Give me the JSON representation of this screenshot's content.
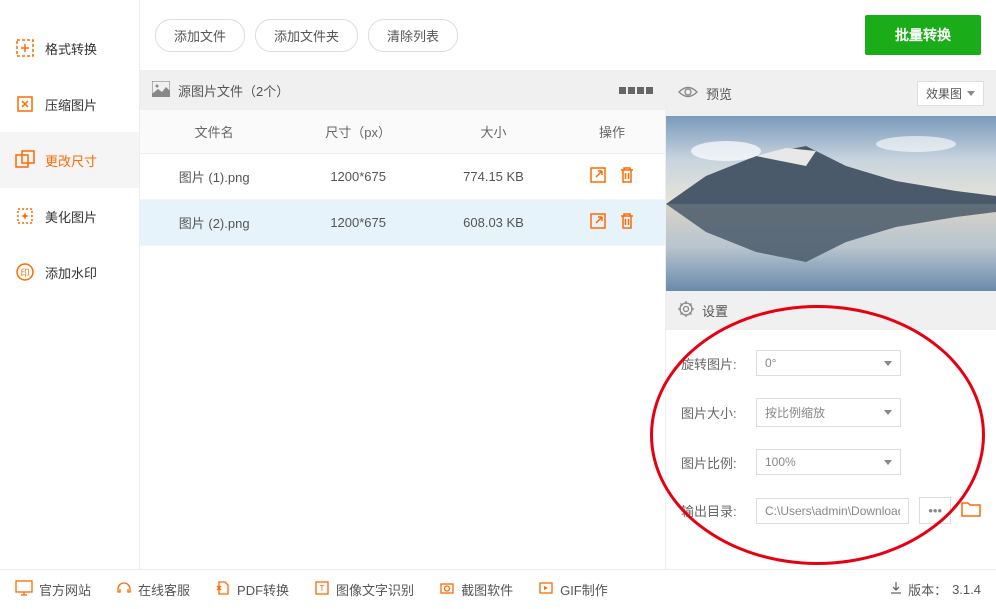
{
  "sidebar": {
    "items": [
      {
        "label": "格式转换"
      },
      {
        "label": "压缩图片"
      },
      {
        "label": "更改尺寸"
      },
      {
        "label": "美化图片"
      },
      {
        "label": "添加水印"
      }
    ]
  },
  "topbar": {
    "add_file": "添加文件",
    "add_folder": "添加文件夹",
    "clear_list": "清除列表",
    "batch": "批量转换"
  },
  "files_header": "源图片文件（2个）",
  "table": {
    "headers": {
      "name": "文件名",
      "dim": "尺寸（px）",
      "size": "大小",
      "ops": "操作"
    },
    "rows": [
      {
        "name": "图片 (1).png",
        "dim": "1200*675",
        "size": "774.15 KB"
      },
      {
        "name": "图片 (2).png",
        "dim": "1200*675",
        "size": "608.03 KB"
      }
    ]
  },
  "preview": {
    "title": "预览",
    "mode": "效果图"
  },
  "settings": {
    "title": "设置",
    "rotate": {
      "label": "旋转图片:",
      "value": "0°"
    },
    "size": {
      "label": "图片大小:",
      "value": "按比例缩放"
    },
    "ratio": {
      "label": "图片比例:",
      "value": "100%"
    },
    "output": {
      "label": "输出目录:",
      "value": "C:\\Users\\admin\\Downloads"
    }
  },
  "bottom": {
    "website": "官方网站",
    "support": "在线客服",
    "pdf": "PDF转换",
    "ocr": "图像文字识别",
    "capture": "截图软件",
    "gif": "GIF制作",
    "version_label": "版本：",
    "version": "3.1.4"
  }
}
